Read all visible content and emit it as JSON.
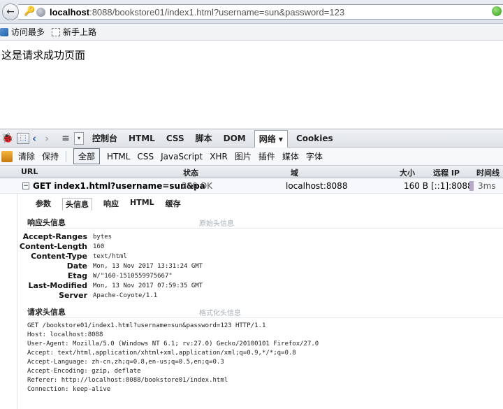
{
  "browser": {
    "url_host": "localhost",
    "url_rest": ":8088/bookstore01/index1.html?username=sun&password=123"
  },
  "bookmarks": [
    {
      "label": "访问最多"
    },
    {
      "label": "新手上路"
    }
  ],
  "page": {
    "text": "这是请求成功页面"
  },
  "firebug": {
    "tabs": [
      "控制台",
      "HTML",
      "CSS",
      "脚本",
      "DOM",
      "网络 ▾",
      "Cookies"
    ],
    "subtoolbar": [
      "清除",
      "保持",
      "全部",
      "HTML",
      "CSS",
      "JavaScript",
      "XHR",
      "图片",
      "插件",
      "媒体",
      "字体"
    ],
    "columns": {
      "url": "URL",
      "status": "状态",
      "domain": "域",
      "size": "大小",
      "remote_ip": "远程 IP",
      "timeline": "时间线"
    },
    "request": {
      "url": "GET index1.html?username=sun&pa",
      "status": "200 OK",
      "domain": "localhost:8088",
      "size": "160 B",
      "remote_ip": "[::1]:8088",
      "time": "3ms"
    },
    "detail_tabs": [
      "参数",
      "头信息",
      "响应",
      "HTML",
      "缓存"
    ],
    "response_section": {
      "title": "响应头信息",
      "link": "原始头信息",
      "headers": [
        {
          "name": "Accept-Ranges",
          "value": "bytes"
        },
        {
          "name": "Content-Length",
          "value": "160"
        },
        {
          "name": "Content-Type",
          "value": "text/html"
        },
        {
          "name": "Date",
          "value": "Mon, 13 Nov 2017 13:31:24 GMT"
        },
        {
          "name": "Etag",
          "value": "W/\"160-1510559975667\""
        },
        {
          "name": "Last-Modified",
          "value": "Mon, 13 Nov 2017 07:59:35 GMT"
        },
        {
          "name": "Server",
          "value": "Apache-Coyote/1.1"
        }
      ]
    },
    "request_section": {
      "title": "请求头信息",
      "link": "格式化头信息",
      "raw_lines": [
        "GET /bookstore01/index1.html?username=sun&password=123 HTTP/1.1",
        "Host: localhost:8088",
        "User-Agent: Mozilla/5.0 (Windows NT 6.1; rv:27.0) Gecko/20100101 Firefox/27.0",
        "Accept: text/html,application/xhtml+xml,application/xml;q=0.9,*/*;q=0.8",
        "Accept-Language: zh-cn,zh;q=0.8,en-us;q=0.5,en;q=0.3",
        "Accept-Encoding: gzip, deflate",
        "Referer: http://localhost:8088/bookstore01/index.html",
        "Connection: keep-alive"
      ]
    }
  }
}
